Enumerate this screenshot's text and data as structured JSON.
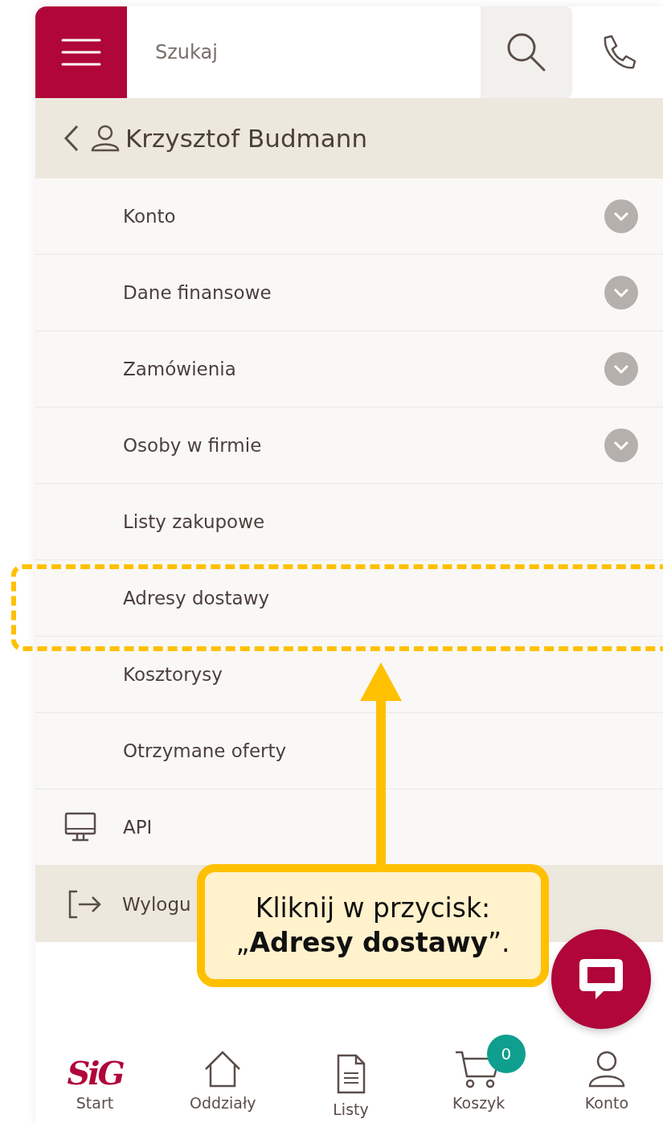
{
  "header": {
    "search": {
      "placeholder": "Szukaj"
    }
  },
  "profile": {
    "name": "Krzysztof Budmann"
  },
  "menu": [
    {
      "label": "Konto",
      "kind": "section",
      "expandable": true
    },
    {
      "label": "Dane finansowe",
      "kind": "section",
      "expandable": true
    },
    {
      "label": "Zamówienia",
      "kind": "section",
      "expandable": true
    },
    {
      "label": "Osoby w firmie",
      "kind": "section",
      "expandable": true
    },
    {
      "label": "Listy zakupowe",
      "kind": "section",
      "expandable": false
    },
    {
      "label": "Adresy dostawy",
      "kind": "section",
      "expandable": false
    },
    {
      "label": "Kosztorysy",
      "kind": "section",
      "expandable": false
    },
    {
      "label": "Otrzymane oferty",
      "kind": "section",
      "expandable": false
    },
    {
      "label": "API",
      "kind": "api",
      "expandable": false
    }
  ],
  "logout": {
    "label": "Wylogu"
  },
  "callout": {
    "text": "Kliknij w przycisk: „**Adresy dostawy**”."
  },
  "bottom_nav": [
    {
      "label": "Start",
      "kind": "logo",
      "logo": "SiG"
    },
    {
      "label": "Oddziały",
      "kind": "home"
    },
    {
      "label": "Listy",
      "kind": "list"
    },
    {
      "label": "Koszyk",
      "kind": "cart",
      "badge": "0"
    },
    {
      "label": "Konto",
      "kind": "user"
    }
  ]
}
